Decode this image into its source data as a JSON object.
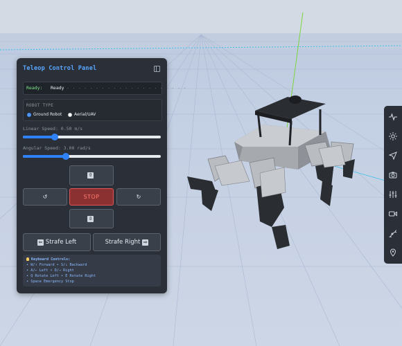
{
  "panel": {
    "title": "Teleop Control Panel",
    "status_label": "Ready:",
    "status_value": "Ready",
    "status_dots": ". . . . . . . . . . . . . . . . . . . . .",
    "robot_type_label": "ROBOT TYPE",
    "robot_types": [
      {
        "label": "Ground Robot",
        "selected": true
      },
      {
        "label": "Aerial/UAV",
        "selected": false
      }
    ],
    "linear_speed_label": "Linear Speed: 0.50 m/s",
    "linear_speed_fraction": 0.23,
    "angular_speed_label": "Angular Speed: 3.00 rad/s",
    "angular_speed_fraction": 0.31,
    "controls": {
      "forward_icon": "⇧",
      "backward_icon": "⇩",
      "rotate_left_icon": "↺",
      "rotate_right_icon": "↻",
      "stop_label": "STOP",
      "strafe_left_label": "Strafe Left",
      "strafe_right_label": "Strafe Right",
      "strafe_left_icon": "⇦",
      "strafe_right_icon": "⇨"
    },
    "keyboard": {
      "title": "Keyboard Controls:",
      "lines": [
        "• W/↑ Forward • S/↓ Backward",
        "• A/← Left • D/→ Right",
        "• Q Rotate Left • E Rotate Right",
        "• Space Emergency Stop"
      ]
    }
  },
  "toolbar": {
    "tools": [
      "pulse-icon",
      "sun-icon",
      "navigate-icon",
      "camera-icon",
      "sliders-icon",
      "video-icon",
      "robot-arm-icon",
      "map-pin-icon"
    ]
  },
  "colors": {
    "panel_bg": "#2b3038",
    "accent": "#2f81f7",
    "title": "#58a6ff",
    "stop": "#8c3131",
    "ready": "#7ee787"
  }
}
